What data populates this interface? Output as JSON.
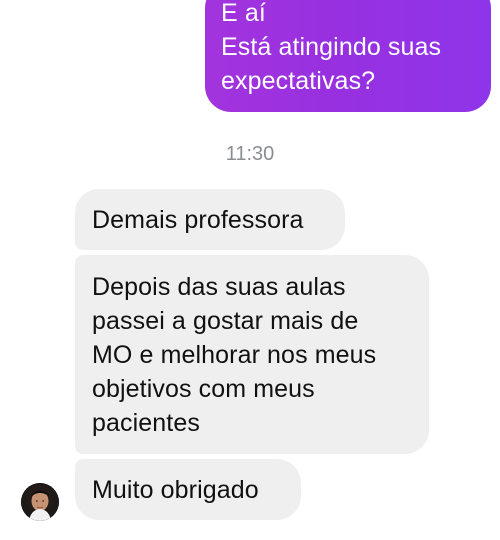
{
  "chat": {
    "sent_message": {
      "lines": [
        "E aí",
        "Está atingindo suas",
        "expectativas?"
      ]
    },
    "timestamp": "11:30",
    "received_messages": [
      {
        "lines": [
          "Demais professora"
        ]
      },
      {
        "lines": [
          "Depois das suas aulas",
          "passei a gostar mais de",
          "MO e melhorar nos meus",
          "objetivos com meus",
          "pacientes"
        ]
      },
      {
        "lines": [
          "Muito obrigado"
        ]
      }
    ]
  },
  "colors": {
    "sent_bubble_start": "#a234dd",
    "sent_bubble_end": "#8e35ea",
    "received_bubble": "#efefef",
    "timestamp_text": "#8a8d91"
  },
  "icons": {
    "avatar": "user-avatar-photo"
  }
}
